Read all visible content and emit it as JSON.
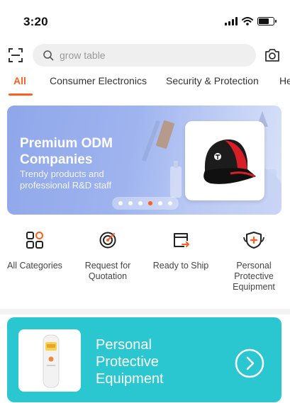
{
  "status": {
    "time": "3:20"
  },
  "search": {
    "placeholder": "grow table"
  },
  "tabs": [
    {
      "label": "All",
      "active": true
    },
    {
      "label": "Consumer Electronics",
      "active": false
    },
    {
      "label": "Security & Protection",
      "active": false
    },
    {
      "label": "He",
      "active": false
    }
  ],
  "banner": {
    "title": "Premium ODM Companies",
    "subtitle": "Trendy products and professional R&D staff",
    "slide_count": 6,
    "active_slide": 4
  },
  "quick_links": [
    {
      "label": "All Categories",
      "icon": "categories-icon"
    },
    {
      "label": "Request for Quotation",
      "icon": "target-icon"
    },
    {
      "label": "Ready to Ship",
      "icon": "ship-box-icon"
    },
    {
      "label": "Personal Protective Equipment",
      "icon": "shield-plus-icon"
    }
  ],
  "promo_card": {
    "title": "Personal Protective Equipment",
    "background_color": "#2ac7d1"
  },
  "colors": {
    "accent": "#ff5e1f",
    "banner": "#9fb4ef"
  }
}
